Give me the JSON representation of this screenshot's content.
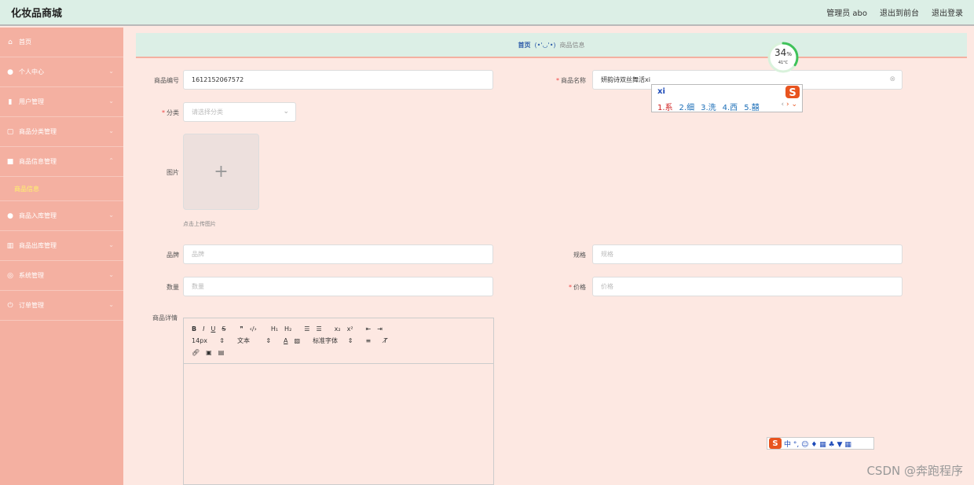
{
  "header": {
    "brand": "化妆品商城",
    "admin": "管理员 abo",
    "back_front": "退出到前台",
    "logout": "退出登录"
  },
  "sidebar": {
    "items": [
      {
        "label": "首页",
        "icon": "home-icon"
      },
      {
        "label": "个人中心",
        "icon": "user-icon"
      },
      {
        "label": "用户管理",
        "icon": "users-icon"
      },
      {
        "label": "商品分类管理",
        "icon": "category-icon"
      },
      {
        "label": "商品信息管理",
        "icon": "goods-icon"
      },
      {
        "label": "商品入库管理",
        "icon": "inbound-icon"
      },
      {
        "label": "商品出库管理",
        "icon": "chart-icon"
      },
      {
        "label": "系统管理",
        "icon": "system-icon"
      },
      {
        "label": "订单管理",
        "icon": "power-icon"
      }
    ],
    "sub_item": "商品信息"
  },
  "breadcrumb": {
    "home": "首页",
    "face": "(•'◡'•)",
    "current": "商品信息"
  },
  "form": {
    "code_label": "商品编号",
    "code_value": "1612152067572",
    "name_label": "商品名称",
    "name_value": "妍韵诗双丝舞活xi",
    "category_label": "分类",
    "category_placeholder": "请选择分类",
    "image_label": "图片",
    "upload_tip": "点击上传图片",
    "brand_label": "品牌",
    "brand_placeholder": "品牌",
    "spec_label": "规格",
    "spec_placeholder": "规格",
    "qty_label": "数量",
    "qty_placeholder": "数量",
    "price_label": "价格",
    "price_placeholder": "价格",
    "detail_label": "商品详情"
  },
  "editor": {
    "font_size": "14px",
    "text_style": "文本",
    "font_family": "标准字体"
  },
  "progress": {
    "percent_value": 34,
    "percent": "34",
    "unit": "%",
    "temp": "41°C"
  },
  "ime": {
    "input": "xi",
    "candidates": [
      "1.系",
      "2.细",
      "3.洗",
      "4.西",
      "5.囍"
    ],
    "bar_text": "中 °, ☺ ♦ ▦ ♣ ▼ ▦"
  },
  "watermark": "CSDN @奔跑程序"
}
